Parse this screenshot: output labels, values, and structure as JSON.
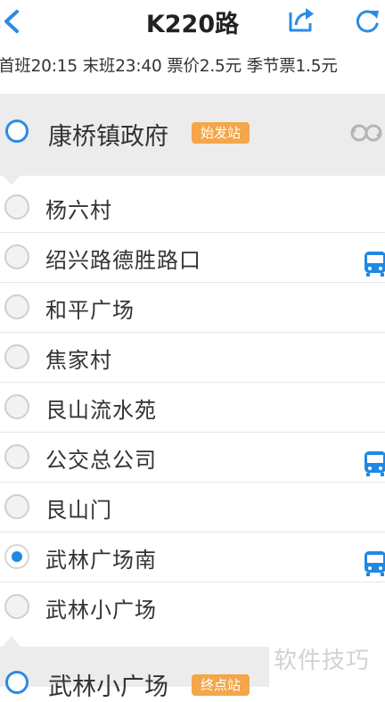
{
  "header": {
    "title": "K220路",
    "back_icon": "chevron-left-icon",
    "share_icon": "share-icon",
    "refresh_icon": "refresh-icon",
    "accent": "#2a8be5"
  },
  "info": {
    "text": "首班20:15 末班23:40 票价2.5元 季节票1.5元"
  },
  "start_stop": {
    "name": "康桥镇政府",
    "badge": "始发站",
    "action_icon": "switch-direction-icon"
  },
  "stops": [
    {
      "name": "杨六村",
      "active": false,
      "bus": false
    },
    {
      "name": "绍兴路德胜路口",
      "active": false,
      "bus": true
    },
    {
      "name": "和平广场",
      "active": false,
      "bus": false
    },
    {
      "name": "焦家村",
      "active": false,
      "bus": false
    },
    {
      "name": "艮山流水苑",
      "active": false,
      "bus": false
    },
    {
      "name": "公交总公司",
      "active": false,
      "bus": true
    },
    {
      "name": "艮山门",
      "active": false,
      "bus": false
    },
    {
      "name": "武林广场南",
      "active": true,
      "bus": true
    },
    {
      "name": "武林小广场",
      "active": false,
      "bus": false
    }
  ],
  "end_stop": {
    "name": "武林小广场",
    "badge": "终点站"
  },
  "watermark": "软件技巧",
  "colors": {
    "badge": "#f4a64a",
    "bus": "#1e88e5",
    "radio_active": "#1e88e5"
  }
}
